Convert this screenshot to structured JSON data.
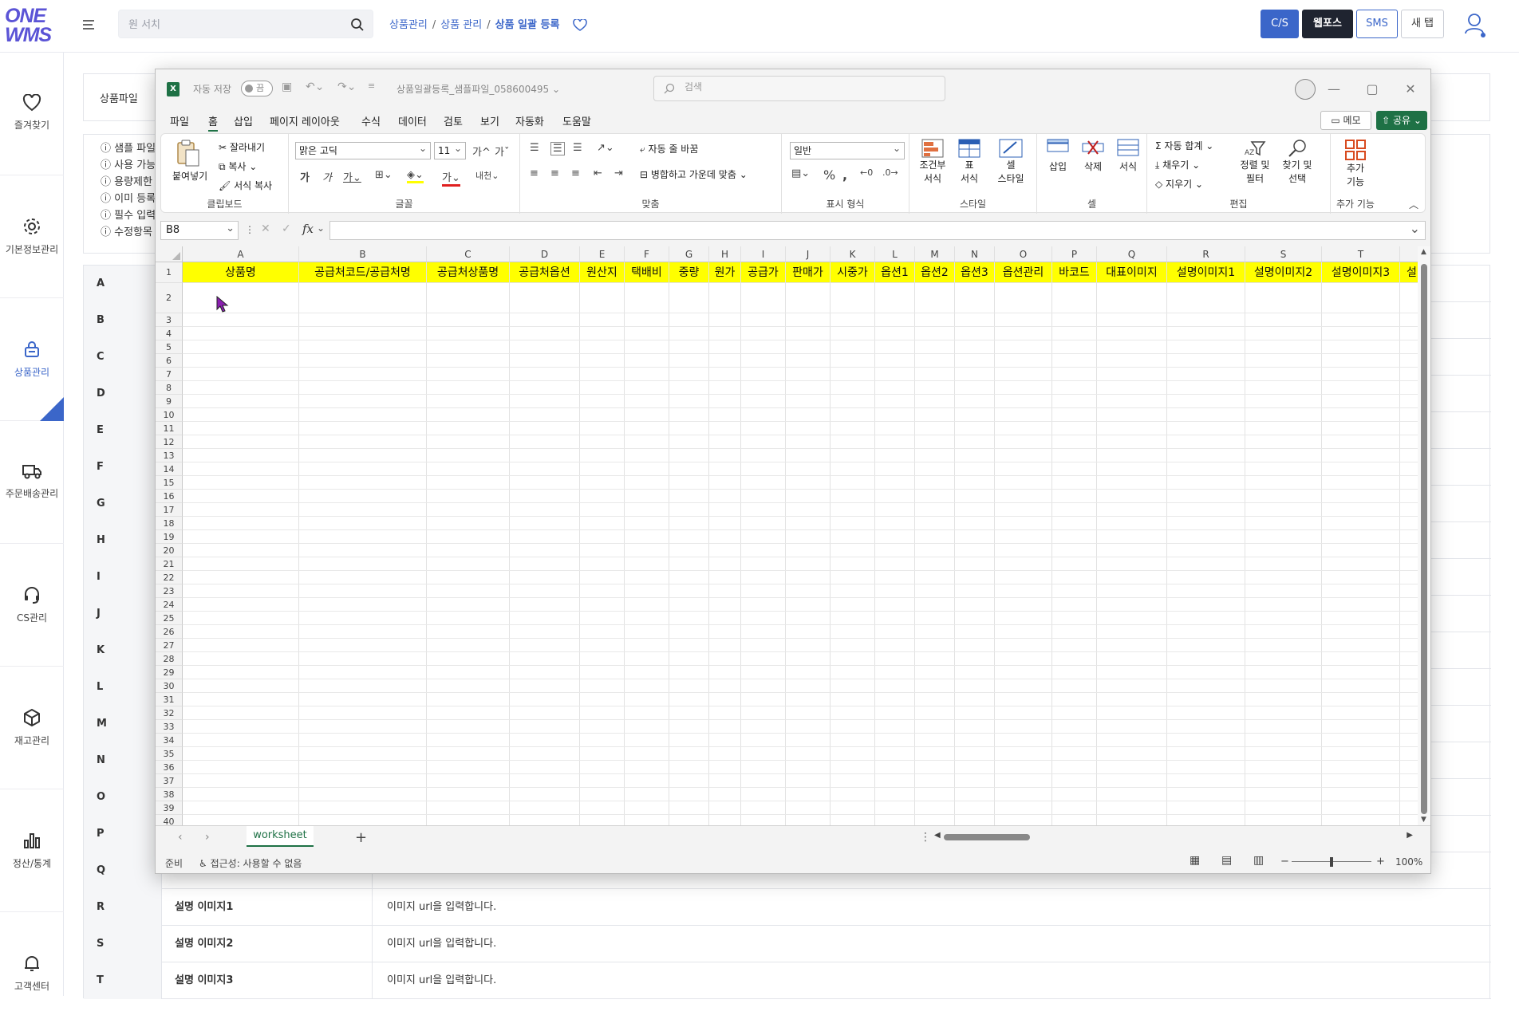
{
  "logo": {
    "line1": "ONE",
    "line2": "WMS"
  },
  "search": {
    "placeholder": "원 서치"
  },
  "breadcrumb": {
    "item1": "상품관리",
    "item2": "상품 관리",
    "current": "상품 일괄 등록",
    "sep": "/"
  },
  "top_buttons": {
    "cs": "C/S",
    "webforce": "웹포스",
    "sms": "SMS",
    "newtab": "새 탭"
  },
  "nav": [
    {
      "label": "즐겨찾기",
      "icon": "heart-icon"
    },
    {
      "label": "기본정보관리",
      "icon": "gear-icon"
    },
    {
      "label": "상품관리",
      "icon": "lock-bag-icon",
      "active": true
    },
    {
      "label": "주문배송관리",
      "icon": "truck-icon"
    },
    {
      "label": "CS관리",
      "icon": "headset-icon"
    },
    {
      "label": "재고관리",
      "icon": "box-icon"
    },
    {
      "label": "정산/통계",
      "icon": "bar-chart-icon"
    },
    {
      "label": "고객센터",
      "icon": "bell-icon"
    }
  ],
  "bg": {
    "file_label": "상품파일",
    "info_items": [
      "샘플 파일",
      "사용 가능",
      "용량제한",
      "이미 등록",
      "필수 입력",
      "수정항목"
    ],
    "rows": [
      {
        "letter": "A"
      },
      {
        "letter": "B"
      },
      {
        "letter": "C"
      },
      {
        "letter": "D"
      },
      {
        "letter": "E"
      },
      {
        "letter": "F"
      },
      {
        "letter": "G"
      },
      {
        "letter": "H"
      },
      {
        "letter": "I"
      },
      {
        "letter": "J"
      },
      {
        "letter": "K"
      },
      {
        "letter": "L"
      },
      {
        "letter": "M"
      },
      {
        "letter": "N"
      },
      {
        "letter": "O"
      },
      {
        "letter": "P"
      },
      {
        "letter": "Q"
      },
      {
        "letter": "R",
        "name": "설명 이미지1",
        "desc": "이미지 url을 입력합니다."
      },
      {
        "letter": "S",
        "name": "설명 이미지2",
        "desc": "이미지 url을 입력합니다."
      },
      {
        "letter": "T",
        "name": "설명 이미지3",
        "desc": "이미지 url을 입력합니다."
      }
    ]
  },
  "excel": {
    "autosave_label": "자동 저장",
    "autosave_state": "끔",
    "filename": "상품일괄등록_샘플파일_058600495",
    "search_placeholder": "검색",
    "menus": [
      "파일",
      "홈",
      "삽입",
      "페이지 레이아웃",
      "수식",
      "데이터",
      "검토",
      "보기",
      "자동화",
      "도움말"
    ],
    "memo": "메모",
    "share": "공유",
    "ribbon": {
      "paste": "붙여넣기",
      "cut": "잘라내기",
      "copy": "복사",
      "format_painter": "서식 복사",
      "clipboard": "클립보드",
      "font_name": "맑은 고딕",
      "font_size": "11",
      "font": "글꼴",
      "wrap": "자동 줄 바꿈",
      "merge": "병합하고 가운데 맞춤",
      "align": "맞춤",
      "number_format": "일반",
      "number": "표시 형식",
      "cond1": "조건부",
      "cond2": "서식",
      "table1": "표",
      "table2": "서식",
      "cellstyle1": "셀",
      "cellstyle2": "스타일",
      "style": "스타일",
      "insert": "삽입",
      "delete": "삭제",
      "format": "서식",
      "cells": "셀",
      "autosum": "자동 합계",
      "fill": "채우기",
      "clear": "지우기",
      "sort1": "정렬 및",
      "sort2": "필터",
      "find1": "찾기 및",
      "find2": "선택",
      "editing": "편집",
      "addins1": "추가",
      "addins2": "기능",
      "addins": "추가 기능"
    },
    "namebox": "B8",
    "columns": [
      {
        "letter": "A",
        "header": "상품명"
      },
      {
        "letter": "B",
        "header": "공급처코드/공급처명"
      },
      {
        "letter": "C",
        "header": "공급처상품명"
      },
      {
        "letter": "D",
        "header": "공급처옵션"
      },
      {
        "letter": "E",
        "header": "원산지"
      },
      {
        "letter": "F",
        "header": "택배비"
      },
      {
        "letter": "G",
        "header": "중량"
      },
      {
        "letter": "H",
        "header": "원가"
      },
      {
        "letter": "I",
        "header": "공급가"
      },
      {
        "letter": "J",
        "header": "판매가"
      },
      {
        "letter": "K",
        "header": "시중가"
      },
      {
        "letter": "L",
        "header": "옵션1"
      },
      {
        "letter": "M",
        "header": "옵션2"
      },
      {
        "letter": "N",
        "header": "옵션3"
      },
      {
        "letter": "O",
        "header": "옵션관리"
      },
      {
        "letter": "P",
        "header": "바코드"
      },
      {
        "letter": "Q",
        "header": "대표이미지"
      },
      {
        "letter": "R",
        "header": "설명이미지1"
      },
      {
        "letter": "S",
        "header": "설명이미지2"
      },
      {
        "letter": "T",
        "header": "설명이미지3"
      },
      {
        "letter": "",
        "header": "설"
      }
    ],
    "row_numbers": [
      "1",
      "2",
      "3",
      "4",
      "5",
      "6",
      "7",
      "8",
      "9",
      "10",
      "11",
      "12",
      "13",
      "14",
      "15",
      "16",
      "17",
      "18",
      "19",
      "20",
      "21",
      "22",
      "23",
      "24",
      "25",
      "26",
      "27",
      "28",
      "29",
      "30",
      "31",
      "32",
      "33",
      "34",
      "35",
      "36",
      "37",
      "38",
      "39",
      "40"
    ],
    "sheet_tab": "worksheet",
    "status_ready": "준비",
    "accessibility": "접근성: 사용할 수 없음",
    "zoom": "100%",
    "colors": {
      "excel_green": "#1e7145",
      "header_fill": "#ffff00",
      "brand": "#5b54d6",
      "accent": "#3b66c9"
    }
  }
}
